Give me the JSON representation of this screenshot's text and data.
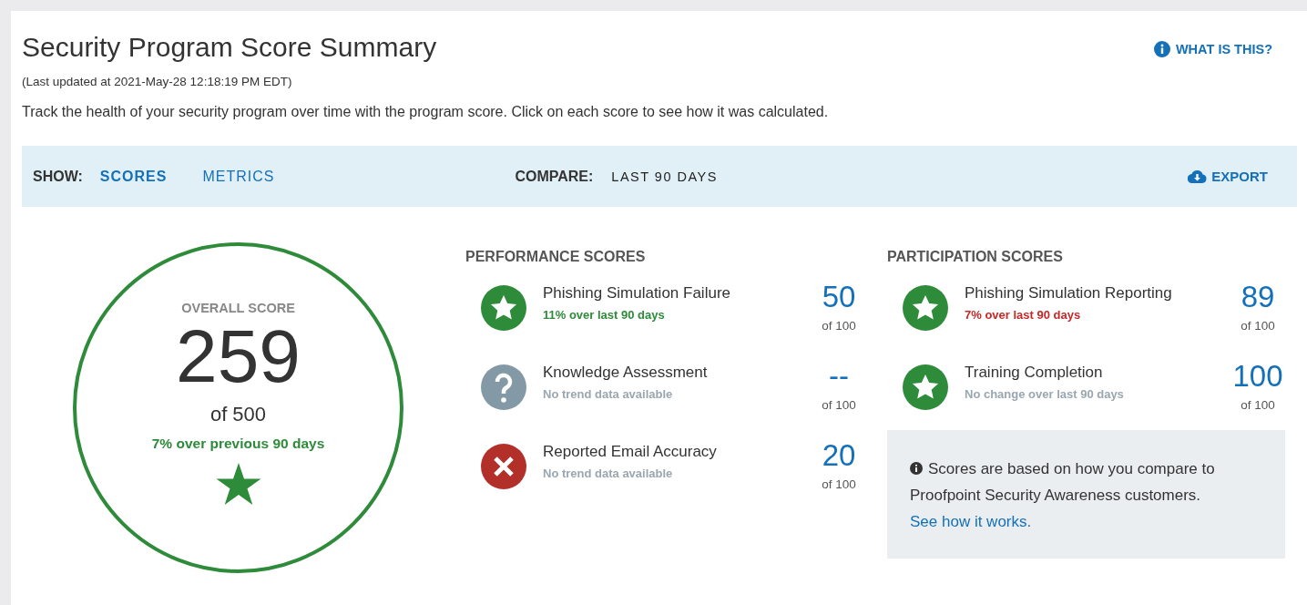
{
  "header": {
    "title": "Security Program Score Summary",
    "updated": "(Last updated at 2021-May-28 12:18:19 PM EDT)",
    "description": "Track the health of your security program over time with the program score. Click on each score to see how it was calculated.",
    "help_link": "WHAT IS THIS?"
  },
  "toolbar": {
    "show_label": "SHOW:",
    "tabs": [
      {
        "label": "SCORES",
        "selected": true
      },
      {
        "label": "METRICS",
        "selected": false
      }
    ],
    "compare_label": "COMPARE:",
    "compare_value": "LAST 90 DAYS",
    "export": "EXPORT"
  },
  "overall": {
    "label": "OVERALL SCORE",
    "score": "259",
    "out_of": "of 500",
    "trend": "7% over previous 90 days",
    "color": "#2e8b3a"
  },
  "sections": [
    {
      "title": "PERFORMANCE SCORES",
      "items": [
        {
          "name": "Phishing Simulation Failure",
          "trend": "11% over last 90 days",
          "color": "#2e8b3a",
          "kind": "star",
          "score": "50",
          "out_of": "of 100"
        },
        {
          "name": "Knowledge Assessment",
          "trend": "No trend data available",
          "color": "#9aa7b0",
          "kind": "unknown",
          "score": "--",
          "out_of": "of 100"
        },
        {
          "name": "Reported Email Accuracy",
          "trend": "No trend data available",
          "color": "#9aa7b0",
          "kind": "fail",
          "score": "20",
          "out_of": "of 100"
        }
      ]
    },
    {
      "title": "PARTICIPATION SCORES",
      "items": [
        {
          "name": "Phishing Simulation Reporting",
          "trend": "7% over last 90 days",
          "color": "#c62828",
          "kind": "star",
          "score": "89",
          "out_of": "of 100"
        },
        {
          "name": "Training Completion",
          "trend": "No change over last 90 days",
          "color": "#9aa7b0",
          "kind": "star",
          "score": "100",
          "out_of": "of 100"
        }
      ]
    }
  ],
  "note": {
    "text": "Scores are based on how you compare to Proofpoint Security Awareness customers.",
    "link": "See how it works."
  }
}
